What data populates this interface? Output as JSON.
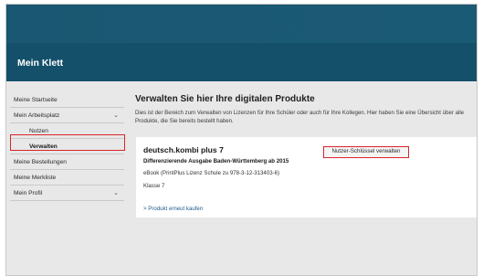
{
  "header": {
    "title": "Mein Klett"
  },
  "sidebar": {
    "items": [
      {
        "label": "Meine Startseite"
      },
      {
        "label": "Mein Arbeitsplatz",
        "chevron": "chevron-down-icon"
      },
      {
        "label": "Nutzen"
      },
      {
        "label": "Verwalten"
      },
      {
        "label": "Meine Bestellungen"
      },
      {
        "label": "Meine Merkliste"
      },
      {
        "label": "Mein Profil",
        "chevron": "chevron-down-icon"
      }
    ],
    "chevron_glyph": "⌄"
  },
  "main": {
    "title": "Verwalten Sie hier Ihre digitalen Produkte",
    "intro": "Dies ist der Bereich zum Verwalten von Lizenzen für Ihre Schüler oder auch für Ihre Kollegen. Hier haben Sie eine Übersicht über alle Produkte, die Sie bereits bestellt haben."
  },
  "product": {
    "title": "deutsch.kombi plus 7",
    "subtitle": "Differenzierende Ausgabe Baden-Württemberg ab 2015",
    "ebook": "eBook (PrintPlus Lizenz Schule zu 978-3-12-313403-6)",
    "klasse": "Klasse 7",
    "rebuy_link": "> Produkt erneut kaufen",
    "key_button": "Nutzer-Schlüssel verwalten"
  },
  "colors": {
    "header": "#15506a",
    "accent_outline": "#d7262c",
    "link": "#1e5a8c"
  }
}
